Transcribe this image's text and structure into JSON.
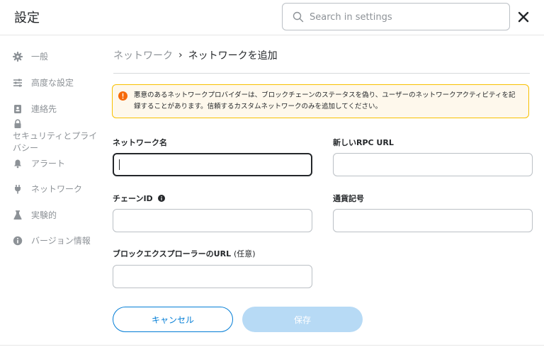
{
  "header": {
    "title": "設定",
    "search_placeholder": "Search in settings"
  },
  "sidebar": {
    "items": [
      {
        "label": "一般",
        "icon": "gear-icon"
      },
      {
        "label": "高度な設定",
        "icon": "sliders-icon"
      },
      {
        "label": "連絡先",
        "icon": "contact-book-icon"
      },
      {
        "label": "セキュリティとプライバシー",
        "icon": "lock-icon"
      },
      {
        "label": "アラート",
        "icon": "bell-icon"
      },
      {
        "label": "ネットワーク",
        "icon": "plug-icon"
      },
      {
        "label": "実験的",
        "icon": "flask-icon"
      },
      {
        "label": "バージョン情報",
        "icon": "info-icon"
      }
    ]
  },
  "breadcrumb": {
    "root": "ネットワーク",
    "separator": "›",
    "current": "ネットワークを追加"
  },
  "warning": {
    "text": "悪意のあるネットワークプロバイダーは、ブロックチェーンのステータスを偽り、ユーザーのネットワークアクティビティを記録することがあります。信頼するカスタムネットワークのみを追加してください。",
    "icon": "warning-icon",
    "color": "#f66a0a"
  },
  "form": {
    "network_name_label": "ネットワーク名",
    "network_name_value": "",
    "rpc_url_label": "新しいRPC URL",
    "rpc_url_value": "",
    "chain_id_label": "チェーンID",
    "chain_id_value": "",
    "currency_symbol_label": "通貨記号",
    "currency_symbol_value": "",
    "explorer_url_label": "ブロックエクスプローラーのURL",
    "explorer_url_optional": "(任意)",
    "explorer_url_value": ""
  },
  "buttons": {
    "cancel": "キャンセル",
    "save": "保存"
  },
  "colors": {
    "primary": "#037dd6",
    "disabled_primary": "#b7daf5",
    "warning_border": "#f8c000",
    "warning_bg": "#fef8ec"
  }
}
